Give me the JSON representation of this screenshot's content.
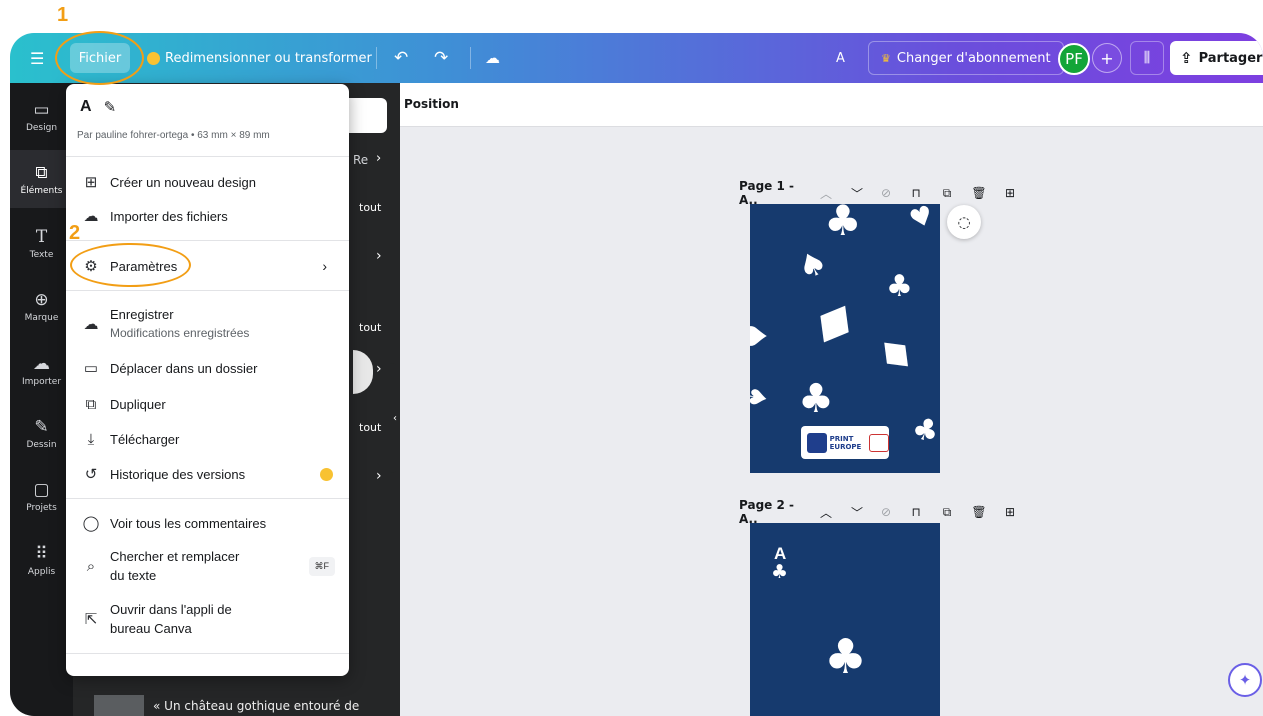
{
  "annotations": {
    "step1": "1",
    "step2": "2"
  },
  "topbar": {
    "hamburger_icon": "☰",
    "file_menu": "Fichier",
    "resize": "Redimensionner ou transformer",
    "text_indicator": "A",
    "upgrade": "Changer d'abonnement",
    "avatar": "PF",
    "add": "+",
    "share": "Partager"
  },
  "sidebar": {
    "items": [
      {
        "label": "Design",
        "icon": "▭"
      },
      {
        "label": "Éléments",
        "icon": "⧉"
      },
      {
        "label": "Texte",
        "icon": "T"
      },
      {
        "label": "Marque",
        "icon": "⊕"
      },
      {
        "label": "Importer",
        "icon": "☁"
      },
      {
        "label": "Dessin",
        "icon": "✎"
      },
      {
        "label": "Projets",
        "icon": "▢"
      },
      {
        "label": "Applis",
        "icon": "⠿"
      }
    ]
  },
  "panel": {
    "fragments": [
      "Re",
      "tout",
      "tout",
      "tout"
    ],
    "caption": "« Un château gothique entouré de"
  },
  "canvas": {
    "ctx_label": "Position",
    "pages": [
      {
        "title": "Page 1 - A..",
        "logo_top": "PRINT",
        "logo_bottom": "EUROPE"
      },
      {
        "title": "Page 2 - A..",
        "corner_letter": "A"
      }
    ]
  },
  "menu": {
    "title": "A",
    "meta": "Par pauline fohrer-ortega • 63 mm × 89 mm",
    "items": [
      {
        "label": "Créer un nouveau design"
      },
      {
        "label": "Importer des fichiers"
      },
      {
        "label": "Paramètres"
      },
      {
        "label": "Enregistrer",
        "sub": "Modifications enregistrées"
      },
      {
        "label": "Déplacer dans un dossier"
      },
      {
        "label": "Dupliquer"
      },
      {
        "label": "Télécharger"
      },
      {
        "label": "Historique des versions"
      },
      {
        "label": "Voir tous les commentaires"
      },
      {
        "label": "Chercher et remplacer",
        "sub": "du texte",
        "shortcut": "⌘F"
      },
      {
        "label": "Ouvrir dans l'appli de",
        "sub": "bureau Canva"
      }
    ]
  }
}
